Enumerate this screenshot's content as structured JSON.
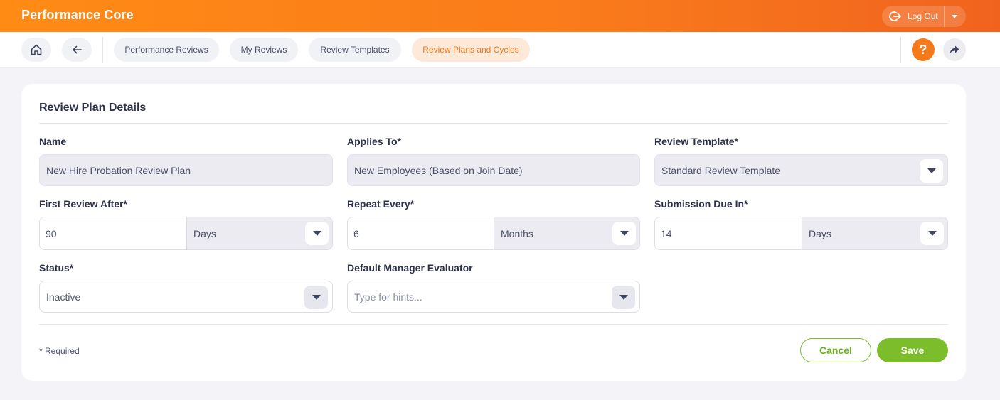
{
  "header": {
    "app_title": "Performance Core",
    "logout_label": "Log Out",
    "brand_color": "#f97a1b"
  },
  "nav": {
    "tabs": [
      {
        "label": "Performance Reviews",
        "active": false
      },
      {
        "label": "My Reviews",
        "active": false
      },
      {
        "label": "Review Templates",
        "active": false
      },
      {
        "label": "Review Plans and Cycles",
        "active": true
      }
    ],
    "help_label": "?"
  },
  "form": {
    "title": "Review Plan Details",
    "name": {
      "label": "Name",
      "value": "New Hire Probation Review Plan"
    },
    "applies_to": {
      "label": "Applies To*",
      "value": "New Employees (Based on Join Date)"
    },
    "review_template": {
      "label": "Review Template*",
      "value": "Standard Review Template"
    },
    "first_review_after": {
      "label": "First Review After*",
      "value": "90",
      "unit": "Days"
    },
    "repeat_every": {
      "label": "Repeat Every*",
      "value": "6",
      "unit": "Months"
    },
    "submission_due_in": {
      "label": "Submission Due In*",
      "value": "14",
      "unit": "Days"
    },
    "status": {
      "label": "Status*",
      "value": "Inactive"
    },
    "default_manager_evaluator": {
      "label": "Default Manager Evaluator",
      "placeholder": "Type for hints..."
    },
    "required_note": "* Required",
    "cancel_label": "Cancel",
    "save_label": "Save",
    "accent_green": "#7cbd2b"
  }
}
